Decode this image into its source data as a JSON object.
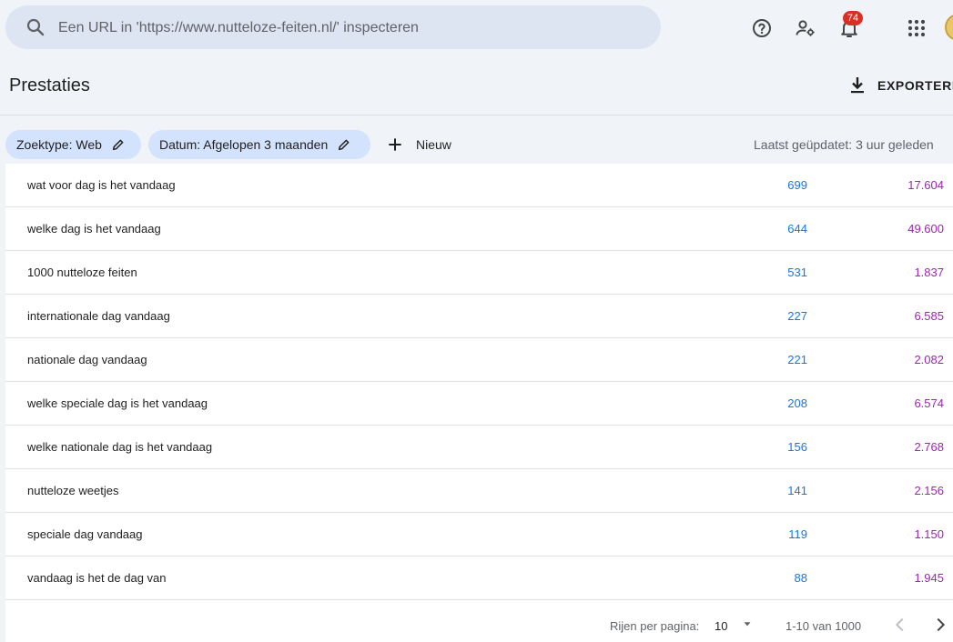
{
  "search": {
    "placeholder": "Een URL in 'https://www.nutteloze-feiten.nl/' inspecteren"
  },
  "topbar": {
    "notification_count": "74"
  },
  "header": {
    "title": "Prestaties",
    "export_label": "EXPORTEREN"
  },
  "filters": {
    "chips": [
      {
        "label": "Zoektype: Web"
      },
      {
        "label": "Datum: Afgelopen 3 maanden"
      }
    ],
    "new_label": "Nieuw",
    "last_updated": "Laatst geüpdatet: 3 uur geleden"
  },
  "table": {
    "rows": [
      {
        "query": "wat voor dag is het vandaag",
        "clicks": "699",
        "impressions": "17.604"
      },
      {
        "query": "welke dag is het vandaag",
        "clicks": "644",
        "impressions": "49.600"
      },
      {
        "query": "1000 nutteloze feiten",
        "clicks": "531",
        "impressions": "1.837"
      },
      {
        "query": "internationale dag vandaag",
        "clicks": "227",
        "impressions": "6.585"
      },
      {
        "query": "nationale dag vandaag",
        "clicks": "221",
        "impressions": "2.082"
      },
      {
        "query": "welke speciale dag is het vandaag",
        "clicks": "208",
        "impressions": "6.574"
      },
      {
        "query": "welke nationale dag is het vandaag",
        "clicks": "156",
        "impressions": "2.768"
      },
      {
        "query": "nutteloze weetjes",
        "clicks": "141",
        "impressions": "2.156"
      },
      {
        "query": "speciale dag vandaag",
        "clicks": "119",
        "impressions": "1.150"
      },
      {
        "query": "vandaag is het de dag van",
        "clicks": "88",
        "impressions": "1.945"
      }
    ]
  },
  "pagination": {
    "rows_per_page_label": "Rijen per pagina:",
    "rows_per_page_value": "10",
    "range_label": "1-10 van 1000"
  },
  "colors": {
    "clicks": "#1a73e8",
    "impressions": "#9c27b0",
    "badge": "#d93025"
  }
}
